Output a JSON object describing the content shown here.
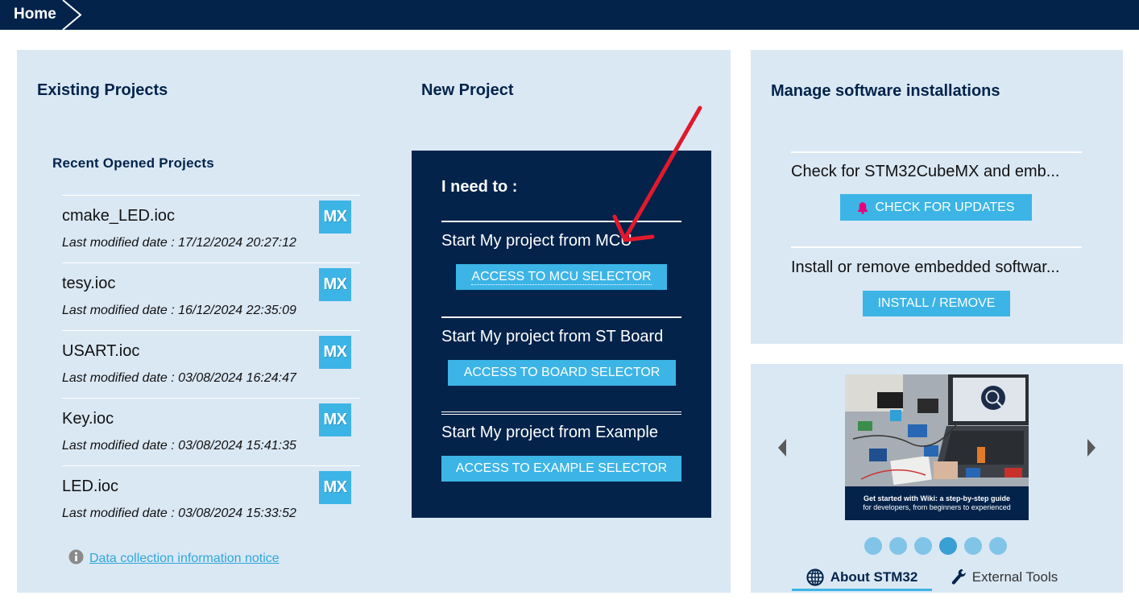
{
  "topbar": {
    "home_label": "Home",
    "chevron_icon": "chevron-right-icon"
  },
  "existing": {
    "title": "Existing Projects",
    "recent_title": "Recent Opened Projects",
    "badge_text": "MX",
    "projects": [
      {
        "name": "cmake_LED.ioc",
        "modified": "Last modified date : 17/12/2024 20:27:12"
      },
      {
        "name": "tesy.ioc",
        "modified": "Last modified date : 16/12/2024 22:35:09"
      },
      {
        "name": "USART.ioc",
        "modified": "Last modified date : 03/08/2024 16:24:47"
      },
      {
        "name": "Key.ioc",
        "modified": "Last modified date : 03/08/2024 15:41:35"
      },
      {
        "name": "LED.ioc",
        "modified": "Last modified date : 03/08/2024 15:33:52"
      }
    ],
    "info_icon": "info-icon",
    "notice_link": "Data collection information notice"
  },
  "new_project": {
    "title": "New Project",
    "prompt": "I need to :",
    "options": [
      {
        "label": "Start My project from MCU",
        "button": "ACCESS TO MCU SELECTOR"
      },
      {
        "label": "Start My project from ST Board",
        "button": "ACCESS TO BOARD SELECTOR"
      },
      {
        "label": "Start My project from Example",
        "button": "ACCESS TO EXAMPLE SELECTOR"
      }
    ]
  },
  "manage": {
    "title": "Manage software installations",
    "check_text": "Check for STM32CubeMX and emb...",
    "check_button": "CHECK FOR UPDATES",
    "check_icon": "bell-icon",
    "install_text": "Install or remove embedded softwar...",
    "install_button": "INSTALL / REMOVE"
  },
  "carousel": {
    "prev_icon": "chevron-left-icon",
    "next_icon": "chevron-right-icon",
    "caption": [
      "Get started with Wiki: a step-by-step guide",
      "for developers, from beginners to experienced"
    ],
    "slide_count": 6,
    "active_slide": 4,
    "tabs": [
      {
        "label": "About STM32",
        "icon": "globe-icon",
        "active": true
      },
      {
        "label": "External Tools",
        "icon": "wrench-icon",
        "active": false
      }
    ]
  },
  "colors": {
    "navy": "#03234B",
    "accent": "#3CB4E6",
    "panel": "#DAE8F4",
    "bell": "#E6007E",
    "annotation_arrow": "#E2192C",
    "link": "#2FA6DC",
    "dot": "#80C4E8",
    "dot_active": "#3A9FD3"
  }
}
